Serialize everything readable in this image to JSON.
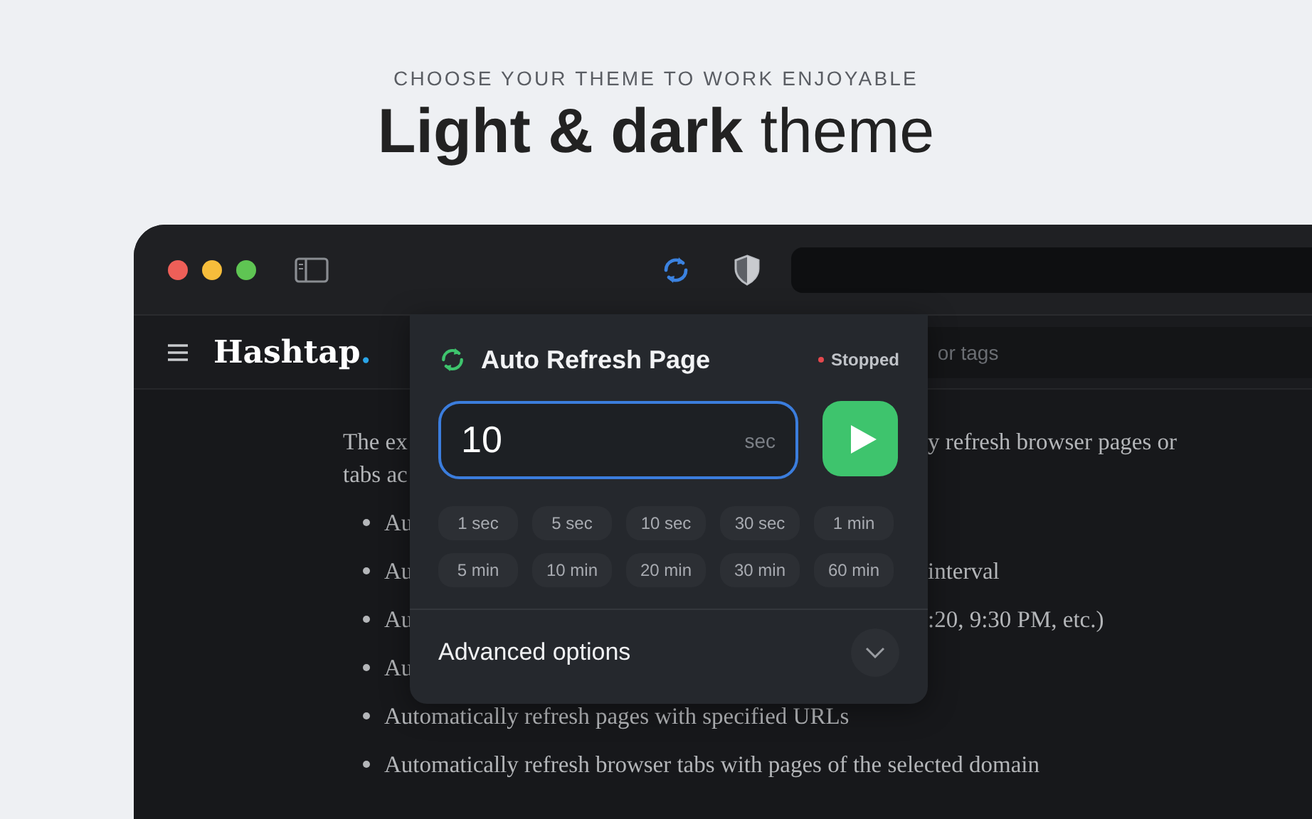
{
  "header": {
    "eyebrow": "CHOOSE YOUR THEME TO WORK ENJOYABLE",
    "title": "**Light & dark** theme"
  },
  "site": {
    "logo": "Hashtap",
    "logo_dot": ".",
    "search": {
      "placeholder": "or tags"
    }
  },
  "article": [
    {
      "kind": "para",
      "left": "The ex",
      "right": "y refresh browser pages or"
    },
    {
      "kind": "para",
      "left": "tabs ac"
    },
    {
      "kind": "bullet",
      "left": "Au"
    },
    {
      "kind": "bullet",
      "left": "Au",
      "right": "interval"
    },
    {
      "kind": "bullet",
      "left": "Au",
      "right": ":20, 9:30 PM, etc.)"
    },
    {
      "kind": "bullet",
      "left": "Au"
    },
    {
      "kind": "bullet",
      "full": "Automatically refresh pages with specified URLs"
    },
    {
      "kind": "bullet",
      "full": "Automatically refresh browser tabs with pages of the selected domain"
    }
  ],
  "popup": {
    "title": "Auto Refresh Page",
    "status": {
      "label": "Stopped",
      "color": "#e5484d"
    },
    "interval": {
      "value": "10",
      "unit": "sec"
    },
    "presets": [
      "1 sec",
      "5 sec",
      "10 sec",
      "30 sec",
      "1 min",
      "5 min",
      "10 min",
      "20 min",
      "30 min",
      "60 min"
    ],
    "advanced": {
      "label": "Advanced options",
      "expanded": false
    }
  }
}
